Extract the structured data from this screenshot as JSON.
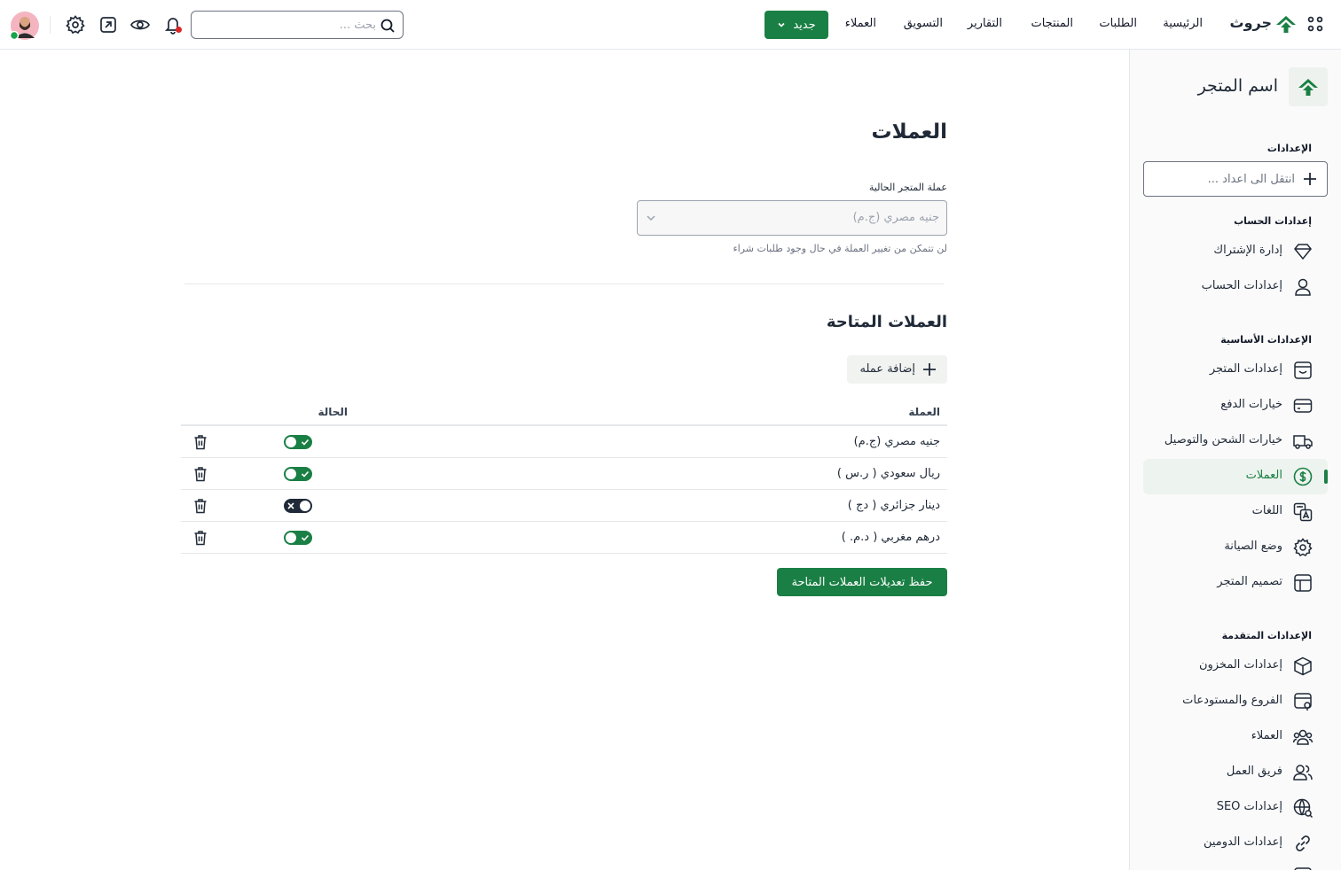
{
  "topbar": {
    "logo_text": "جروث",
    "nav": [
      "الرئيسية",
      "الطلبات",
      "المنتجات",
      "التقارير",
      "التسويق",
      "العملاء"
    ],
    "new_label": "جديد",
    "search_placeholder": "بحث ..."
  },
  "sidebar": {
    "store_name": "اسم المتجر",
    "settings_title": "الإعدادات",
    "search_placeholder": "انتقل الى اعداد ...",
    "account_title": "إعدادات الحساب",
    "account_items": [
      {
        "label": "إدارة الإشتراك",
        "icon": "diamond-icon"
      },
      {
        "label": "إعدادات الحساب",
        "icon": "user-icon"
      }
    ],
    "basic_title": "الإعدادات الأساسية",
    "basic_items": [
      {
        "label": "إعدادات المتجر",
        "icon": "store-icon"
      },
      {
        "label": "خيارات الدفع",
        "icon": "credit-card-icon"
      },
      {
        "label": "خيارات الشحن والتوصيل",
        "icon": "truck-icon"
      },
      {
        "label": "العملات",
        "icon": "dollar-icon"
      },
      {
        "label": "اللغات",
        "icon": "language-icon"
      },
      {
        "label": "وضع الصيانة",
        "icon": "maintenance-gear-icon"
      },
      {
        "label": "تصميم المتجر",
        "icon": "layout-icon"
      }
    ],
    "advanced_title": "الإعدادات المتقدمة",
    "advanced_items": [
      {
        "label": "إعدادات المخزون",
        "icon": "box-icon"
      },
      {
        "label": "الفروع والمستودعات",
        "icon": "branch-icon"
      },
      {
        "label": "العملاء",
        "icon": "customers-icon"
      },
      {
        "label": "فريق العمل",
        "icon": "team-icon"
      },
      {
        "label": "إعدادات SEO",
        "icon": "globe-icon"
      },
      {
        "label": "إعدادات الدومين",
        "icon": "link-icon"
      }
    ]
  },
  "main": {
    "title": "العملات",
    "current_label": "عملة المتجر الحالية",
    "current_value": "جنيه مصري (ج.م)",
    "help_text": "لن تتمكن من تغيير العملة في حال وجود طلبات شراء",
    "available_title": "العملات المتاحة",
    "add_label": "إضافة عمله",
    "col_currency": "العملة",
    "col_status": "الحالة",
    "rows": [
      {
        "name": "جنيه مصري (ج.م)",
        "enabled": true
      },
      {
        "name": "ريال سعودي ( ر.س )",
        "enabled": true
      },
      {
        "name": "دينار جزائري ( دج )",
        "enabled": false
      },
      {
        "name": "درهم مغربي ( د.م. )",
        "enabled": true
      }
    ],
    "save_label": "حفظ تعديلات العملات المتاحة"
  },
  "colors": {
    "accent": "#1a7f44",
    "notification_dot": "#dc2626",
    "online_dot": "#16a34a"
  }
}
